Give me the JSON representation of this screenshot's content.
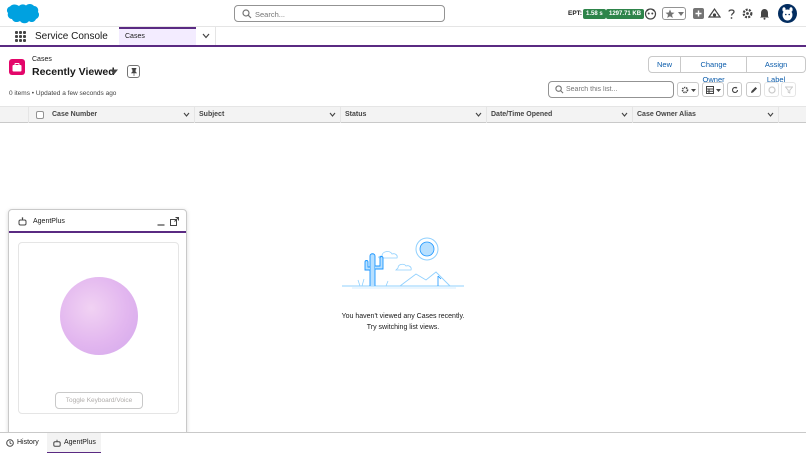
{
  "header": {
    "search_placeholder": "Search...",
    "ept_label": "EPT:",
    "ept_time": "1.58 s",
    "ept_size": "1297.71 KB"
  },
  "nav": {
    "app_name": "Service Console",
    "tab_label": "Cases"
  },
  "list": {
    "object_label": "Cases",
    "title": "Recently Viewed",
    "status": "0 items • Updated a few seconds ago",
    "search_placeholder": "Search this list...",
    "buttons": [
      "New",
      "Change Owner",
      "Assign Label"
    ],
    "columns": [
      "Case Number",
      "Subject",
      "Status",
      "Date/Time Opened",
      "Case Owner Alias"
    ]
  },
  "empty_state": {
    "line1": "You haven't viewed any Cases recently.",
    "line2": "Try switching list views."
  },
  "agent_panel": {
    "title": "AgentPlus",
    "toggle_label": "Toggle Keyboard/Voice"
  },
  "utility_bar": {
    "items": [
      "History",
      "AgentPlus"
    ]
  },
  "colors": {
    "brand_blue": "#0b5cab",
    "accent_purple": "#5a2a82",
    "cases_pink": "#e3066a",
    "ept_green": "#2e844a"
  }
}
